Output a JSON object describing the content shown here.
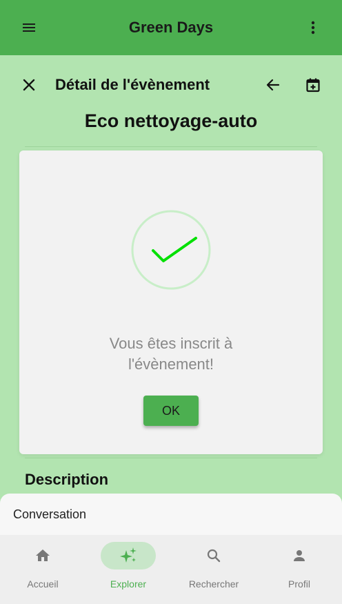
{
  "appbar": {
    "title": "Green Days",
    "menu_icon": "hamburger-menu-icon",
    "more_icon": "more-vert-icon"
  },
  "subheader": {
    "title": "Détail de l'évènement",
    "close_icon": "close-icon",
    "back_icon": "arrow-back-icon",
    "calendar_icon": "calendar-add-icon"
  },
  "event": {
    "title": "Eco nettoyage-auto"
  },
  "dialog": {
    "message_line1": "Vous êtes inscrit à",
    "message_line2": "l'évènement!",
    "ok_label": "OK",
    "icon": "check-circle-icon"
  },
  "section": {
    "description_label": "Description"
  },
  "sheet": {
    "title": "Conversation"
  },
  "bottom_nav": {
    "items": [
      {
        "label": "Accueil",
        "icon": "home-icon",
        "active": false
      },
      {
        "label": "Explorer",
        "icon": "sparkle-icon",
        "active": true
      },
      {
        "label": "Rechercher",
        "icon": "search-icon",
        "active": false
      },
      {
        "label": "Profil",
        "icon": "person-icon",
        "active": false
      }
    ]
  },
  "colors": {
    "primary": "#4caf50",
    "background": "#b2e4b0",
    "check": "#00e000",
    "active_pill": "#c8e6c9"
  }
}
